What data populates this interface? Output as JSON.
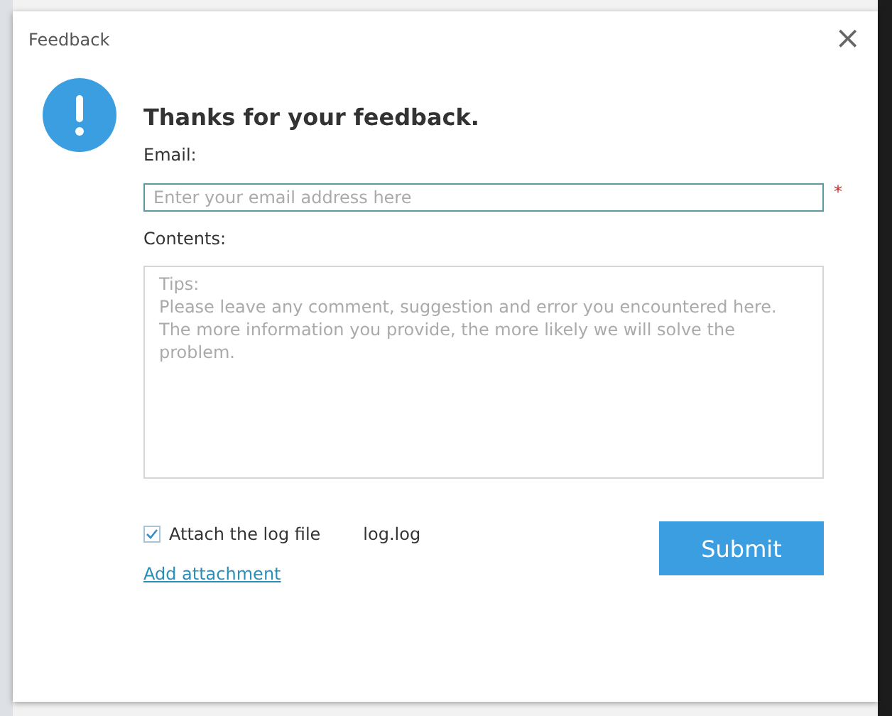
{
  "window": {
    "title": "Feedback",
    "close": "×"
  },
  "heading": "Thanks for your feedback.",
  "email": {
    "label": "Email:",
    "placeholder": "Enter your email address here",
    "required_mark": "*"
  },
  "contents": {
    "label": "Contents:",
    "placeholder": "Tips:\nPlease leave any comment, suggestion and error you encountered here. The more information you provide, the more likely we will solve the problem."
  },
  "attach_log": {
    "label": "Attach the log file",
    "checked": true,
    "file": "log.log"
  },
  "add_attachment": "Add attachment",
  "buttons": [
    "Submit"
  ]
}
